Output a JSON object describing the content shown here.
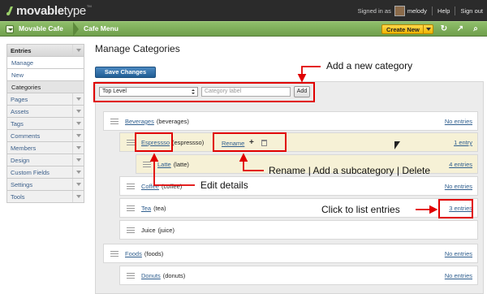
{
  "header": {
    "logo_bold": "movable",
    "logo_light": "type",
    "logo_tm": "TM",
    "signed_in_as": "Signed in as",
    "username": "melody",
    "help": "Help",
    "sign_out": "Sign out"
  },
  "blogbar": {
    "blog_name": "Movable Cafe",
    "site_name": "Cafe Menu",
    "create_label": "Create New"
  },
  "sidebar": {
    "entries_label": "Entries",
    "entries_subitems": [
      {
        "label": "Manage"
      },
      {
        "label": "New"
      },
      {
        "label": "Categories"
      }
    ],
    "items": [
      {
        "label": "Pages"
      },
      {
        "label": "Assets"
      },
      {
        "label": "Tags"
      },
      {
        "label": "Comments"
      },
      {
        "label": "Members"
      },
      {
        "label": "Design"
      },
      {
        "label": "Custom Fields"
      },
      {
        "label": "Settings"
      },
      {
        "label": "Tools"
      }
    ]
  },
  "main": {
    "title": "Manage Categories",
    "save_label": "Save Changes",
    "parent_select_value": "Top Level",
    "label_placeholder": "Category label",
    "add_label": "Add"
  },
  "categories": [
    {
      "name": "Beverages",
      "basename": "(beverages)",
      "entries": "No entries",
      "linked": true
    },
    {
      "name": "Espressso",
      "basename": "(espressso)",
      "entries": "1 entry",
      "linked": true
    },
    {
      "name": "Latte",
      "basename": "(latte)",
      "entries": "4 entries",
      "linked": true
    },
    {
      "name": "Coffee",
      "basename": "(coffee)",
      "entries": "No entries",
      "linked": true
    },
    {
      "name": "Tea",
      "basename": "(tea)",
      "entries": "3 entries",
      "linked": true
    },
    {
      "name": "Juice",
      "basename": "(juice)",
      "entries": "",
      "linked": false
    },
    {
      "name": "Foods",
      "basename": "(foods)",
      "entries": "No entries",
      "linked": true
    },
    {
      "name": "Donuts",
      "basename": "(donuts)",
      "entries": "No entries",
      "linked": true
    }
  ],
  "row_actions": {
    "rename": "Rename"
  },
  "annotations": {
    "add_category": "Add a new category",
    "rename_add_delete": "Rename | Add a subcategory | Delete",
    "edit_details": "Edit details",
    "list_entries": "Click to list entries"
  },
  "colors": {
    "callout": "#e00000",
    "blogbar": "#7aab55",
    "save_button": "#215e95",
    "create_button": "#f0b400"
  }
}
